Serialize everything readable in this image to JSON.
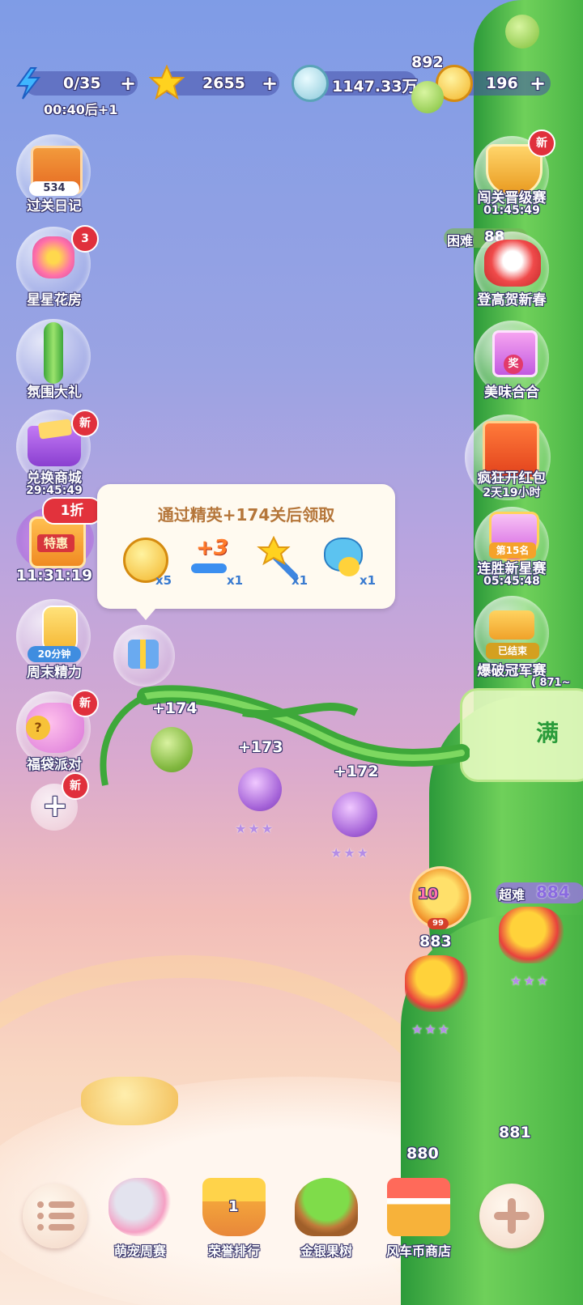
{
  "resources": {
    "energy": {
      "value": "0/35",
      "timer": "00:40后+1",
      "icon": "lightning-icon"
    },
    "stars": {
      "value": "2655",
      "icon": "star-icon"
    },
    "silver": {
      "value": "1147.33万",
      "icon": "silver-coin-icon"
    },
    "gold": {
      "value": "196",
      "icon": "gold-coin-icon"
    },
    "plus": "+"
  },
  "left_menu": [
    {
      "label": "过关日记",
      "badge": "534",
      "icon": "diary-gift-icon"
    },
    {
      "label": "星星花房",
      "badge": "3",
      "icon": "flower-pot-icon"
    },
    {
      "label": "氛围大礼",
      "icon": "beanstalk-gift-icon"
    },
    {
      "label": "兑换商城",
      "badge": "新",
      "timer": "29:45:49",
      "icon": "ticket-bag-icon"
    },
    {
      "label": "特惠",
      "badge": "1折",
      "timer": "11:31:19",
      "icon": "shop-sale-icon"
    },
    {
      "label": "周末精力",
      "badge": "20分钟",
      "icon": "energy-bottle-icon"
    },
    {
      "label": "福袋派对",
      "badge": "新",
      "icon": "lucky-bag-icon"
    },
    {
      "label": "+",
      "badge": "新",
      "icon": "add-icon"
    }
  ],
  "right_menu": [
    {
      "label": "闯关晋级赛",
      "badge": "新",
      "timer": "01:45:49",
      "icon": "shield-badge-icon"
    },
    {
      "label": "登高贺新春",
      "icon": "lion-dance-icon"
    },
    {
      "label": "美味合合",
      "badge": "奖",
      "icon": "gift-box-icon"
    },
    {
      "label": "疯狂开红包",
      "timer": "2天19小时",
      "icon": "red-packet-icon"
    },
    {
      "label": "连胜新星赛",
      "badge": "第15名",
      "timer": "05:45:48",
      "icon": "winstreak-badge-icon"
    },
    {
      "label": "爆破冠军赛",
      "badge": "已结束",
      "icon": "trophy-icon"
    }
  ],
  "map": {
    "top_level": "892",
    "difficulty_hard": "困难",
    "hard_level": "88",
    "super_hard": "超难",
    "super_hard_level": "884",
    "right_text_fragment": "满",
    "range_fragment": "( 871~",
    "nodes": [
      {
        "label": "+174"
      },
      {
        "label": "+173",
        "stars": "★★★"
      },
      {
        "label": "+172",
        "stars": "★★★"
      }
    ],
    "levels": [
      {
        "label": "883",
        "stars": "★★★",
        "avatar_badge": "10",
        "avatar_sub": "99"
      },
      {
        "label": "881"
      },
      {
        "label": "880"
      }
    ],
    "super_hard_stars": "★★★"
  },
  "tooltip": {
    "title": "通过精英+174关后领取",
    "rewards": [
      {
        "icon": "gold-coin-icon",
        "count": "x5"
      },
      {
        "icon": "plus-three-moves-icon",
        "text": "+3",
        "count": "x1"
      },
      {
        "icon": "magic-wand-icon",
        "count": "x1"
      },
      {
        "icon": "hippo-chick-icon",
        "count": "x1"
      }
    ]
  },
  "bottom_bar": [
    {
      "label": "",
      "icon": "menu-icon"
    },
    {
      "label": "萌宠周赛",
      "icon": "cat-shell-icon"
    },
    {
      "label": "荣誉排行",
      "icon": "crown-podium-icon",
      "rank": "1"
    },
    {
      "label": "金银果树",
      "icon": "fruit-tree-icon"
    },
    {
      "label": "风车币商店",
      "icon": "shop-stall-icon"
    },
    {
      "label": "",
      "icon": "add-icon"
    }
  ],
  "colors": {
    "badge_red": "#e0303c",
    "tooltip_title": "#b5763a",
    "stalk_green": "#46b344"
  }
}
